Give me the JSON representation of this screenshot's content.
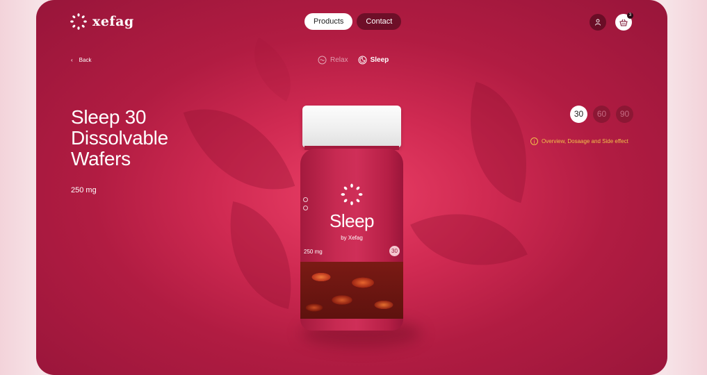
{
  "brand": {
    "name": "xefag"
  },
  "nav": {
    "products_label": "Products",
    "contact_label": "Contact"
  },
  "header": {
    "cart_count": "3"
  },
  "back": {
    "label": "Back"
  },
  "modes": [
    {
      "label": "Relax",
      "icon": "relax-icon",
      "active": false
    },
    {
      "label": "Sleep",
      "icon": "moon-icon",
      "active": true
    }
  ],
  "product": {
    "title_lines": [
      "Sleep 30",
      "Dissolvable",
      "Wafers"
    ],
    "dose": "250 mg"
  },
  "quantity": {
    "options": [
      "30",
      "60",
      "90"
    ],
    "selected": "30"
  },
  "info": {
    "label": "Overview, Dosaage and Side effect"
  },
  "bottle": {
    "name": "Sleep",
    "by": "by Xefag",
    "dose": "250 mg",
    "count": "30"
  },
  "colors": {
    "background": "#c8254f",
    "accent": "#f1c24a",
    "dark": "#6e0f28"
  }
}
